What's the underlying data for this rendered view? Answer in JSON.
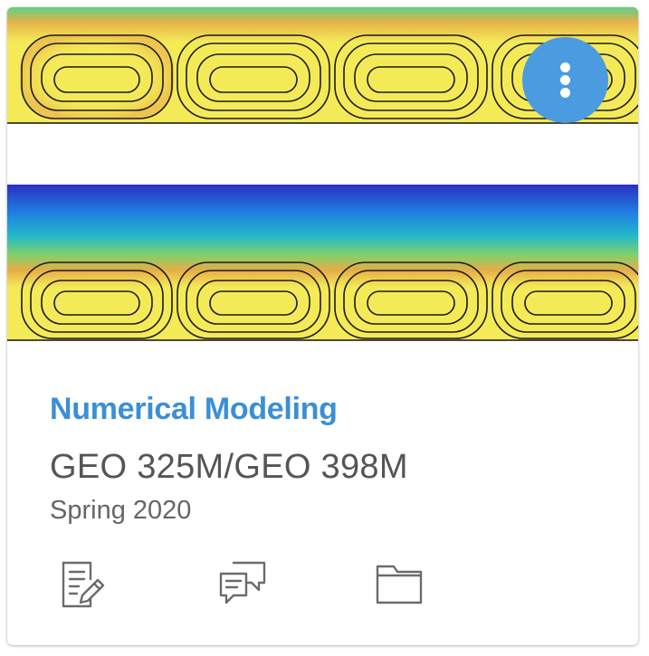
{
  "card": {
    "course_name": "Numerical Modeling",
    "course_code": "GEO 325M/GEO 398M",
    "term": "Spring 2020",
    "colors": {
      "course_name": "#3b8fd6",
      "menu_button": "#4a9be0",
      "action_icon": "#6b6b6b"
    }
  },
  "hero_image": {
    "description_icon": "convection-cells-image",
    "gradient_colors": [
      "#2b34c4",
      "#1f8de0",
      "#22c6c0",
      "#7fd46a",
      "#e8b84a",
      "#f2ec55"
    ]
  },
  "menu_button": {
    "icon": "vertical-ellipsis-icon"
  },
  "actions": [
    {
      "icon": "assignments-icon"
    },
    {
      "icon": "discussions-icon"
    },
    {
      "icon": "files-icon"
    }
  ]
}
